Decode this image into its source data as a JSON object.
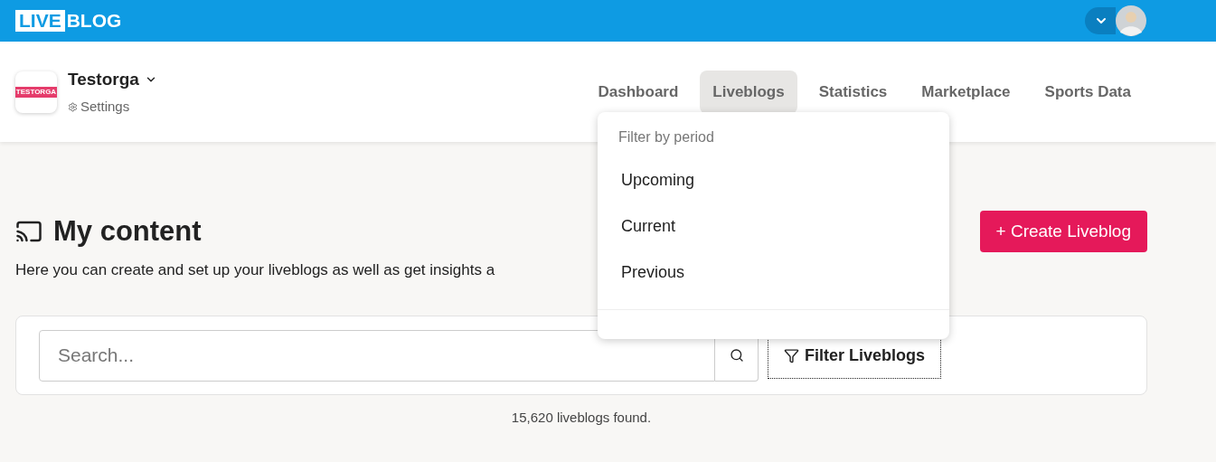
{
  "brand": {
    "boxed": "LIVE",
    "rest": "BLOG"
  },
  "org": {
    "logo_text": "TESTORGA",
    "name": "Testorga",
    "settings": "Settings"
  },
  "nav": [
    {
      "label": "Dashboard",
      "selected": false
    },
    {
      "label": "Liveblogs",
      "selected": true
    },
    {
      "label": "Statistics",
      "selected": false
    },
    {
      "label": "Marketplace",
      "selected": false
    },
    {
      "label": "Sports Data",
      "selected": false
    }
  ],
  "dropdown": {
    "heading": "Filter by period",
    "items": [
      "Upcoming",
      "Current",
      "Previous"
    ]
  },
  "page": {
    "title": "My content",
    "description": "Here you can create and set up your liveblogs as well as get insights a",
    "create_button": "+ Create Liveblog"
  },
  "search": {
    "placeholder": "Search...",
    "filter_button": "Filter Liveblogs"
  },
  "result_count": "15,620 liveblogs found."
}
